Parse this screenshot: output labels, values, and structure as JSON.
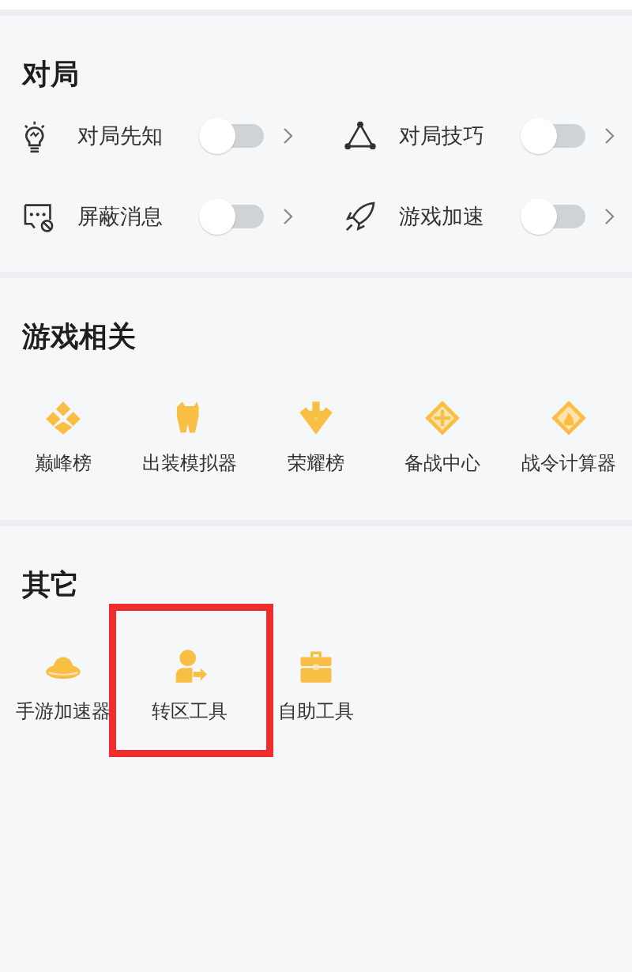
{
  "sections": [
    {
      "title": "对局",
      "kind": "toggles",
      "items": [
        {
          "label": "对局先知",
          "on": false
        },
        {
          "label": "对局技巧",
          "on": false
        },
        {
          "label": "屏蔽消息",
          "on": false
        },
        {
          "label": "游戏加速",
          "on": false
        }
      ]
    },
    {
      "title": "游戏相关",
      "kind": "tools",
      "items": [
        {
          "label": "巅峰榜",
          "highlighted": false
        },
        {
          "label": "出装模拟器",
          "highlighted": false
        },
        {
          "label": "荣耀榜",
          "highlighted": false
        },
        {
          "label": "备战中心",
          "highlighted": false
        },
        {
          "label": "战令计算器",
          "highlighted": false
        }
      ]
    },
    {
      "title": "其它",
      "kind": "tools",
      "items": [
        {
          "label": "手游加速器",
          "highlighted": false
        },
        {
          "label": "转区工具",
          "highlighted": true
        },
        {
          "label": "自助工具",
          "highlighted": false
        }
      ]
    }
  ]
}
